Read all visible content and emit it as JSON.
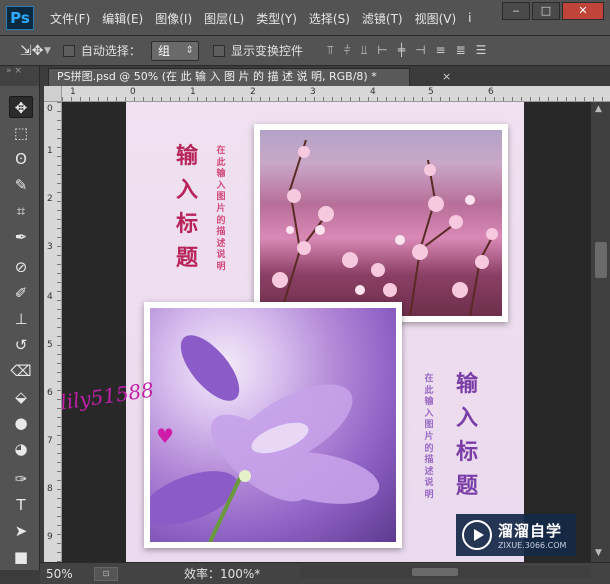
{
  "app": {
    "logo": "Ps",
    "menu": [
      "文件(F)",
      "编辑(E)",
      "图像(I)",
      "图层(L)",
      "类型(Y)",
      "选择(S)",
      "滤镜(T)",
      "视图(V)",
      "i"
    ],
    "window_buttons": {
      "minimize": "‒",
      "maximize": "□",
      "close": "✕"
    }
  },
  "options_bar": {
    "tool_icon": "move-tool-icon",
    "auto_select_label": "自动选择：",
    "auto_select_value": "组",
    "show_transform_label": "显示变换控件"
  },
  "document_tab": {
    "title": "PS拼图.psd @ 50% (在 此 输 入 图 片 的 描 述 说 明, RGB/8) *",
    "close": "×"
  },
  "rulers": {
    "top": [
      "1",
      "0",
      "1",
      "2",
      "3",
      "4",
      "5",
      "6"
    ],
    "left": [
      "0",
      "1",
      "2",
      "3",
      "4",
      "5",
      "6",
      "7",
      "8",
      "9"
    ]
  },
  "canvas": {
    "title_1": [
      "输",
      "入",
      "标",
      "题"
    ],
    "desc_1": [
      "在",
      "此",
      "输",
      "入",
      "图",
      "片",
      "的",
      "描",
      "述",
      "说",
      "明"
    ],
    "title_2": [
      "输",
      "入",
      "标",
      "题"
    ],
    "desc_2": [
      "在",
      "此",
      "输",
      "入",
      "图",
      "片",
      "的",
      "描",
      "述",
      "说",
      "明"
    ],
    "signature": "lily51588",
    "heart": "♥"
  },
  "status": {
    "zoom": "50%",
    "efficiency": "效率：100%*"
  },
  "brand": {
    "name": "溜溜自学",
    "url": "ZIXUE.3066.COM"
  },
  "colors": {
    "accent_ps": "#31a8ff",
    "title_pink": "#b7245a",
    "title_purple": "#7a3ea6",
    "signature": "#c11fa8"
  }
}
